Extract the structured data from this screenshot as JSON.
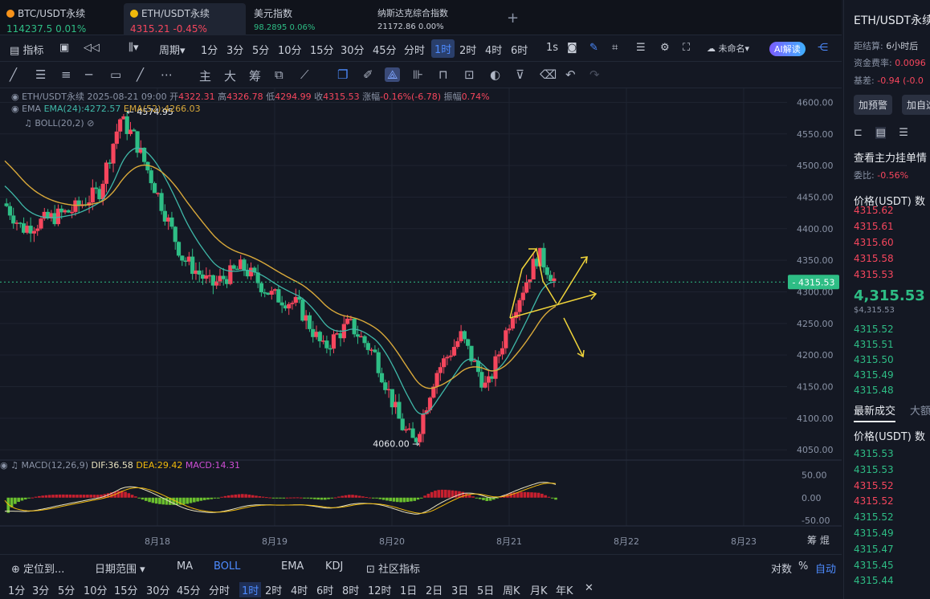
{
  "tabs": [
    {
      "name": "BTC/USDT永续",
      "price": "114237.5",
      "change": "0.01%",
      "color": "#2ebd85"
    },
    {
      "name": "ETH/USDT永续",
      "price": "4315.21",
      "change": "-0.45%",
      "color": "#f6465d"
    },
    {
      "name": "美元指数",
      "price": "98.2895",
      "change": "0.06%",
      "color": "#2ebd85"
    },
    {
      "name": "纳斯达克综合指数",
      "price": "21172.86",
      "change": "0.00%",
      "color": "#c9ced8"
    }
  ],
  "toolbar": {
    "indicator": "指标",
    "period": "周期",
    "intervals": [
      "1分",
      "3分",
      "5分",
      "10分",
      "15分",
      "30分",
      "45分",
      "分时",
      "1时",
      "2时",
      "4时",
      "6时",
      "1s"
    ],
    "selected_interval": "1时",
    "unnamed": "未命名",
    "ai": "AI解读"
  },
  "drawbar": {
    "labels": [
      "主",
      "大",
      "筹"
    ]
  },
  "info": {
    "symbol": "ETH/USDT永续",
    "time": "2025-08-21 09:00",
    "open_label": "开",
    "open": "4322.31",
    "high_label": "高",
    "high": "4326.78",
    "low_label": "低",
    "low": "4294.99",
    "close_label": "收",
    "close": "4315.53",
    "chg_label": "涨幅",
    "chg": "-0.16%(-6.78)",
    "amp_label": "振幅",
    "amp": "0.74%",
    "ema_label": "EMA",
    "ema24": "EMA(24):4272.57",
    "ema52": "EMA(52):4266.03",
    "boll": "BOLL(20,2)"
  },
  "annotations": {
    "high": "4574.95",
    "low": "4060.00",
    "last_price": "4315.53"
  },
  "macd": {
    "label": "MACD(12,26,9)",
    "dif": "DIF:36.58",
    "dea": "DEA:29.42",
    "macd": "MACD:14.31"
  },
  "axis": {
    "price_ticks": [
      "4600.00",
      "4550.00",
      "4500.00",
      "4450.00",
      "4400.00",
      "4350.00",
      "4300.00",
      "4250.00",
      "4200.00",
      "4150.00",
      "4100.00",
      "4050.00"
    ],
    "macd_ticks": [
      "50.00",
      "0.00",
      "-50.00"
    ],
    "dates": [
      "8月18",
      "8月19",
      "8月20",
      "8月21",
      "8月22",
      "8月23"
    ],
    "corner": [
      "筹",
      "焜"
    ]
  },
  "colors": {
    "up": "#f6465d",
    "down": "#2ebd85",
    "ema24": "#3fb8a8",
    "ema52": "#d9a93a",
    "arrow": "#f0d43a",
    "accent": "#4d8bff"
  },
  "bottom1": {
    "locate": "定位到...",
    "range": "日期范围",
    "ma": "MA",
    "boll": "BOLL",
    "ema": "EMA",
    "kdj": "KDJ",
    "community": "社区指标",
    "log": "对数",
    "percent": "%",
    "auto": "自动"
  },
  "bottom2": {
    "items": [
      "1分",
      "3分",
      "5分",
      "10分",
      "15分",
      "30分",
      "45分",
      "分时",
      "1时",
      "2时",
      "4时",
      "6时",
      "8时",
      "12时",
      "1日",
      "2日",
      "3日",
      "5日",
      "周K",
      "月K",
      "年K"
    ],
    "selected": "1时"
  },
  "right": {
    "title": "ETH/USDT永续",
    "settle_label": "距结算:",
    "settle_value": "6小时后",
    "funding_label": "资金费率:",
    "funding_value": "0.0096",
    "basis_label": "基差:",
    "basis_value": "-0.94 (-0.0",
    "alert": "加预警",
    "custom": "加自选",
    "depth_title": "查看主力挂单情",
    "ratio_label": "委比:",
    "ratio_value": "-0.56%",
    "price_header": "价格(USDT)",
    "qty_header": "数",
    "asks": [
      "4315.62",
      "4315.61",
      "4315.60",
      "4315.58",
      "4315.53"
    ],
    "mid": "4,315.53",
    "mid_sub": "$4,315.53",
    "bids": [
      "4315.52",
      "4315.51",
      "4315.50",
      "4315.49",
      "4315.48"
    ],
    "trades_tab": "最新成交",
    "big_tab": "大额",
    "trades_header": "价格(USDT)",
    "trades": [
      {
        "p": "4315.53",
        "c": "#2ebd85"
      },
      {
        "p": "4315.53",
        "c": "#2ebd85"
      },
      {
        "p": "4315.52",
        "c": "#f6465d"
      },
      {
        "p": "4315.52",
        "c": "#f6465d"
      },
      {
        "p": "4315.52",
        "c": "#2ebd85"
      },
      {
        "p": "4315.49",
        "c": "#2ebd85"
      },
      {
        "p": "4315.47",
        "c": "#2ebd85"
      },
      {
        "p": "4315.45",
        "c": "#2ebd85"
      },
      {
        "p": "4315.44",
        "c": "#2ebd85"
      }
    ]
  }
}
